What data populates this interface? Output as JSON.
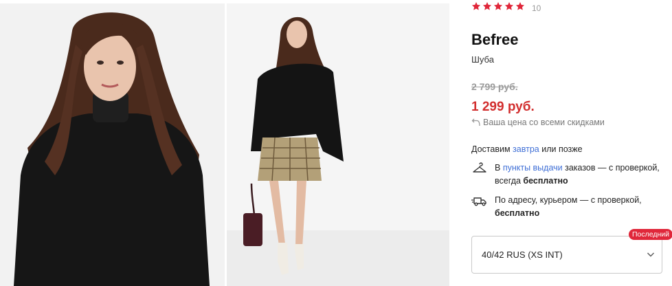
{
  "gallery": {
    "photos": [
      {
        "alt": "model-closeup"
      },
      {
        "alt": "model-full-body"
      }
    ]
  },
  "rating": {
    "stars": 5,
    "count": "10",
    "star_color": "#e0273a"
  },
  "product": {
    "brand": "Befree",
    "type": "Шуба",
    "old_price": "2 799 руб.",
    "new_price": "1 299 руб.",
    "price_note": "Ваша цена со всеми скидками"
  },
  "delivery": {
    "prefix": "Доставим ",
    "day": "завтра",
    "suffix": " или позже",
    "pickup": {
      "text_before": "В ",
      "link": "пункты выдачи",
      "text_after": " заказов — с проверкой, всегда ",
      "bold": "бесплатно"
    },
    "courier": {
      "text": "По адресу, курьером — с проверкой, ",
      "bold": "бесплатно"
    }
  },
  "size_selector": {
    "value": "40/42 RUS (XS INT)",
    "badge": "Последний"
  },
  "colors": {
    "accent_red": "#d22e2e",
    "link_blue": "#3f6fd6"
  }
}
